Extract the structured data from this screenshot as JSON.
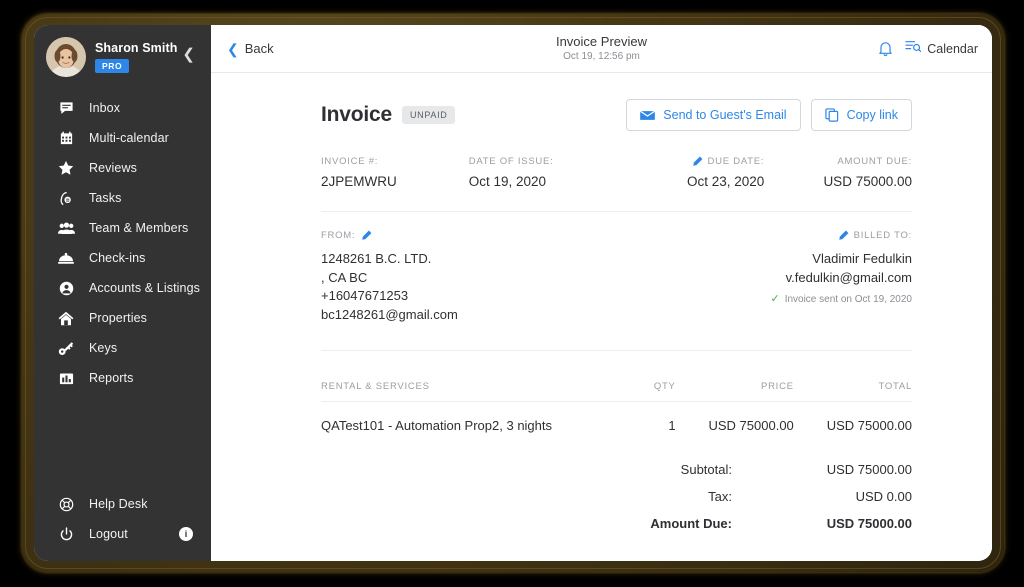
{
  "sidebar": {
    "user": {
      "name": "Sharon Smith",
      "badge": "PRO"
    },
    "collapse_icon": "chevron-left-icon",
    "items": [
      {
        "label": "Inbox",
        "icon": "chat-icon"
      },
      {
        "label": "Multi-calendar",
        "icon": "calendar-icon"
      },
      {
        "label": "Reviews",
        "icon": "star-icon"
      },
      {
        "label": "Tasks",
        "icon": "tasks-icon"
      },
      {
        "label": "Team & Members",
        "icon": "people-icon"
      },
      {
        "label": "Check-ins",
        "icon": "bell-desk-icon"
      },
      {
        "label": "Accounts & Listings",
        "icon": "account-circle-icon"
      },
      {
        "label": "Properties",
        "icon": "home-icon"
      },
      {
        "label": "Keys",
        "icon": "key-icon"
      },
      {
        "label": "Reports",
        "icon": "bar-chart-icon"
      }
    ],
    "bottom_items": [
      {
        "label": "Help Desk",
        "icon": "lifebuoy-icon",
        "count": ""
      },
      {
        "label": "Logout",
        "icon": "power-icon",
        "count": "i"
      }
    ]
  },
  "topbar": {
    "back_label": "Back",
    "title": "Invoice Preview",
    "subtitle": "Oct 19, 12:56 pm",
    "bell_icon": "bell-icon",
    "calendar_icon": "calendar-search-icon",
    "calendar_label": "Calendar"
  },
  "invoice": {
    "title": "Invoice",
    "status": "UNPAID",
    "send_label": "Send to Guest's Email",
    "copy_label": "Copy link",
    "meta": [
      {
        "key": "INVOICE #:",
        "value": "2JPEMWRU",
        "editable": false,
        "align": "left"
      },
      {
        "key": "DATE OF ISSUE:",
        "value": "Oct 19, 2020",
        "editable": false,
        "align": "left"
      },
      {
        "key": "DUE DATE:",
        "value": "Oct 23, 2020",
        "editable": true,
        "align": "right"
      },
      {
        "key": "AMOUNT DUE:",
        "value": "USD 75000.00",
        "editable": false,
        "align": "right"
      }
    ],
    "from": {
      "key": "FROM:",
      "lines": [
        "1248261 B.C. LTD.",
        ", CA BC",
        "+16047671253",
        "bc1248261@gmail.com"
      ]
    },
    "billed_to": {
      "key": "BILLED TO:",
      "lines": [
        "Vladimir Fedulkin",
        "v.fedulkin@gmail.com"
      ],
      "sent_note": "Invoice sent on Oct 19, 2020"
    },
    "table": {
      "headers": [
        "RENTAL & SERVICES",
        "QTY",
        "PRICE",
        "TOTAL"
      ],
      "rows": [
        {
          "description": "QATest101 - Automation Prop2, 3 nights",
          "qty": "1",
          "price": "USD 75000.00",
          "total": "USD 75000.00"
        }
      ]
    },
    "totals": [
      {
        "key": "Subtotal:",
        "value": "USD 75000.00",
        "bold": false
      },
      {
        "key": "Tax:",
        "value": "USD 0.00",
        "bold": false
      },
      {
        "key": "Amount Due:",
        "value": "USD 75000.00",
        "bold": true
      }
    ]
  },
  "colors": {
    "accent": "#2e87e8",
    "sidebar_bg": "#333333",
    "badge_bg": "#2e87e8",
    "status_bg": "#e6e8ea",
    "check_green": "#4caf50"
  }
}
